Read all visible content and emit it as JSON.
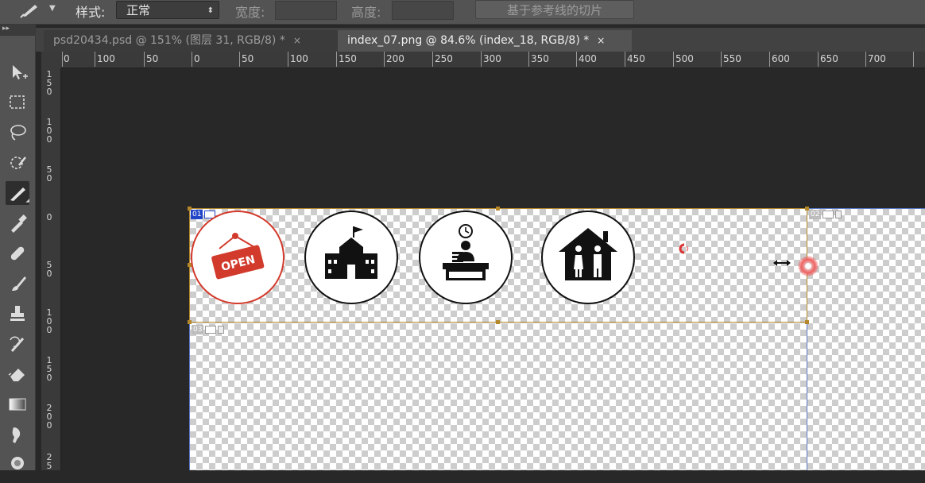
{
  "options_bar": {
    "style_label": "样式:",
    "style_value": "正常",
    "width_label": "宽度:",
    "height_label": "高度:",
    "guides_button": "基于参考线的切片"
  },
  "toolbar": {
    "collapse": "▸▸",
    "tools": [
      "move-tool",
      "marquee-tool",
      "lasso-tool",
      "quick-select-tool",
      "slice-tool",
      "eyedropper-tool",
      "healing-brush-tool",
      "brush-tool",
      "clone-stamp-tool",
      "history-brush-tool",
      "eraser-tool",
      "gradient-tool",
      "smudge-tool",
      "dodge-tool"
    ],
    "active": "slice-tool"
  },
  "tabs": [
    {
      "label": "psd20434.psd @ 151% (图层 31, RGB/8) *",
      "close": "×",
      "active": false
    },
    {
      "label": "index_07.png @ 84.6% (index_18, RGB/8) *",
      "close": "×",
      "active": true
    }
  ],
  "ruler": {
    "h_ticks": [
      "0",
      "100",
      "50",
      "0",
      "50",
      "100",
      "150",
      "200",
      "250",
      "300",
      "350",
      "400",
      "450",
      "500",
      "550",
      "600",
      "650",
      "700"
    ],
    "v_ticks": [
      "1\n5\n0",
      "1\n0\n0",
      "5\n0",
      "0",
      "5\n0",
      "1\n0\n0",
      "1\n5\n0",
      "2\n0\n0",
      "2\n5"
    ]
  },
  "slices": {
    "slice1": "01",
    "slice2": "02",
    "slice3": "03"
  },
  "icons": {
    "open_sign_text": "OPEN"
  },
  "colors": {
    "accent_red": "#d23a2c",
    "slice_border": "#b4882a",
    "guide_blue": "#5a78c8",
    "slice_badge_blue": "#2346c8"
  }
}
